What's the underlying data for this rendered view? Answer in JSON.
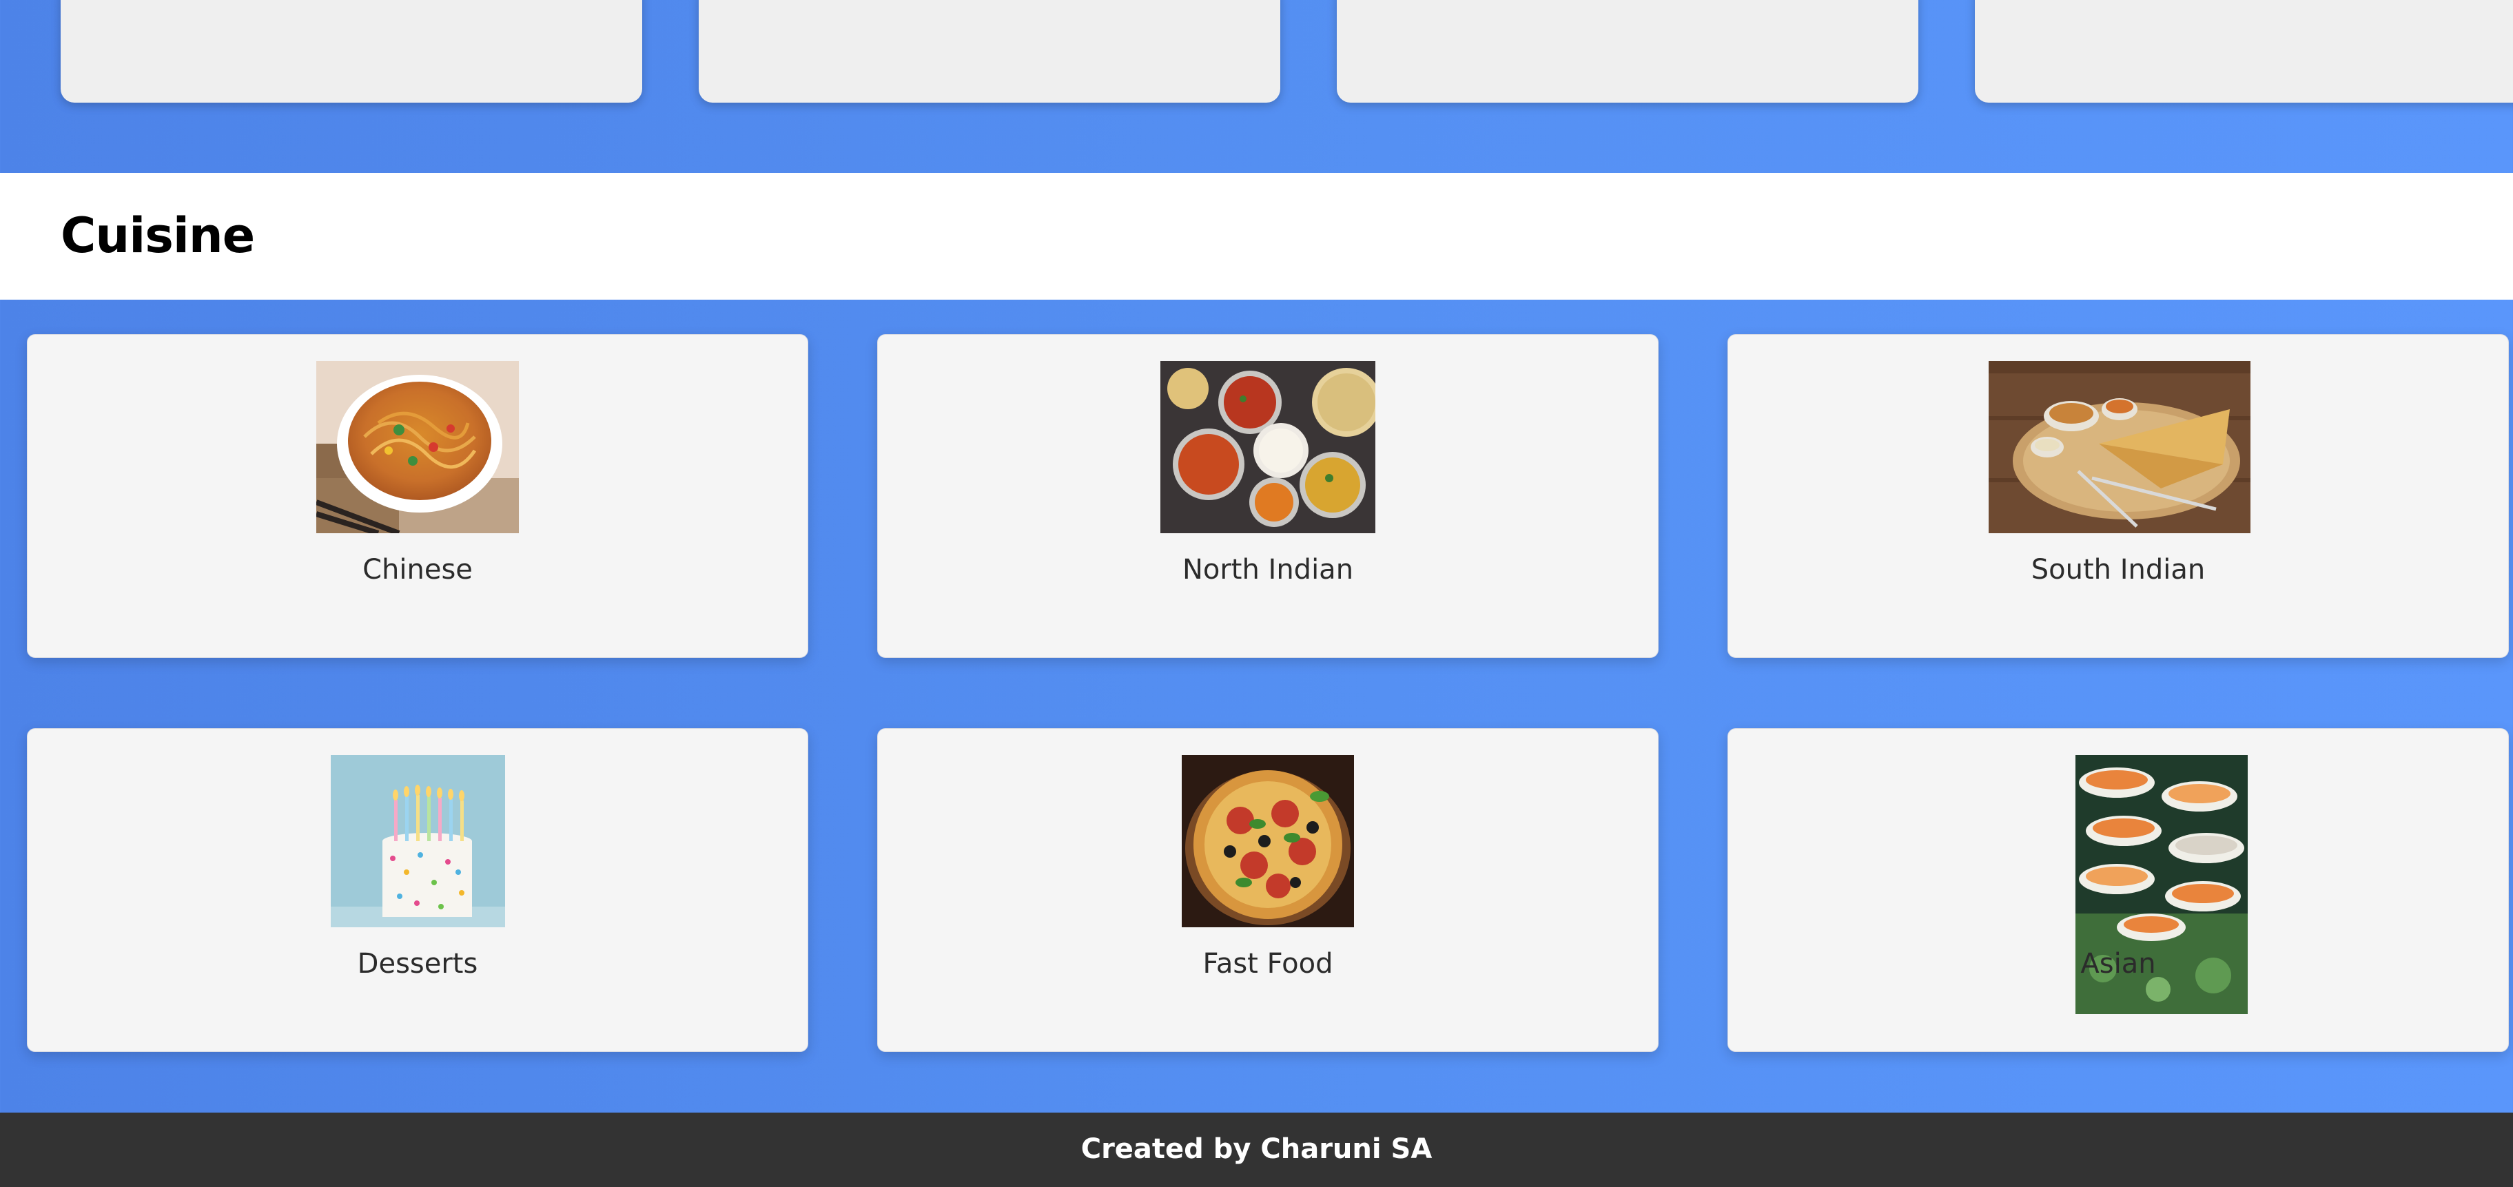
{
  "section": {
    "title": "Cuisine"
  },
  "cuisines": [
    {
      "label": "Chinese",
      "image": "noodles-bowl-image"
    },
    {
      "label": "North Indian",
      "image": "curries-platter-image"
    },
    {
      "label": "South Indian",
      "image": "dosa-plate-image"
    },
    {
      "label": "Desserts",
      "image": "birthday-cake-image"
    },
    {
      "label": "Fast Food",
      "image": "pizza-image"
    },
    {
      "label": "Asian",
      "image": "sushi-image"
    }
  ],
  "footer": {
    "text": "Created by Charuni SA"
  },
  "colors": {
    "background": "#5590f3",
    "header": "#ffffff",
    "card": "#f5f5f5",
    "footer": "#333333"
  }
}
